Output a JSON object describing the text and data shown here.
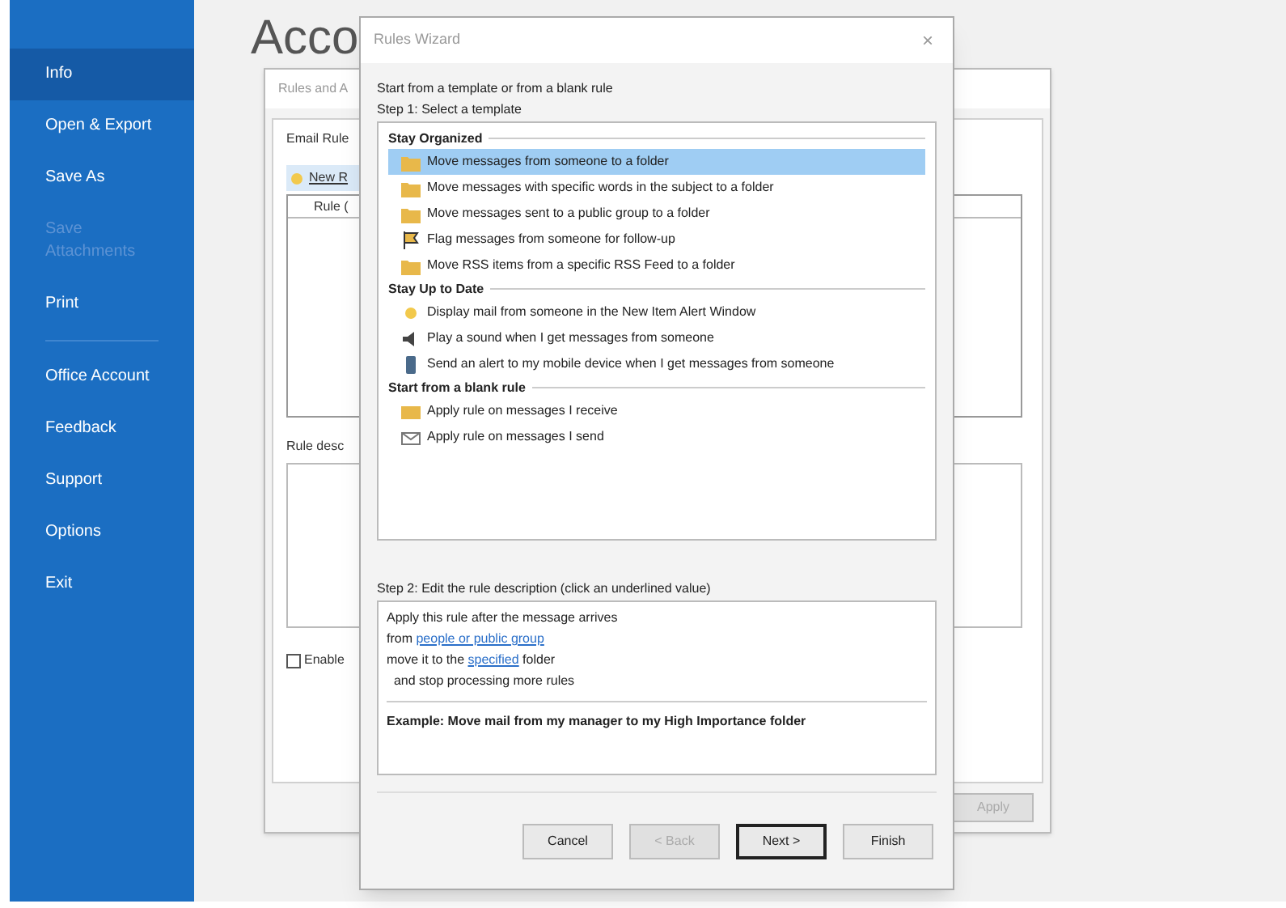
{
  "sidebar": {
    "items": [
      {
        "label": "Info",
        "selected": true,
        "disabled": false,
        "divider_after": false
      },
      {
        "label": "Open & Export",
        "selected": false,
        "disabled": false,
        "divider_after": false
      },
      {
        "label": "Save As",
        "selected": false,
        "disabled": false,
        "divider_after": false
      },
      {
        "label": "Save Attachments",
        "selected": false,
        "disabled": true,
        "divider_after": false
      },
      {
        "label": "Print",
        "selected": false,
        "disabled": false,
        "divider_after": true
      },
      {
        "label": "Office Account",
        "selected": false,
        "disabled": false,
        "divider_after": false
      },
      {
        "label": "Feedback",
        "selected": false,
        "disabled": false,
        "divider_after": false
      },
      {
        "label": "Support",
        "selected": false,
        "disabled": false,
        "divider_after": false
      },
      {
        "label": "Options",
        "selected": false,
        "disabled": false,
        "divider_after": false
      },
      {
        "label": "Exit",
        "selected": false,
        "disabled": false,
        "divider_after": false
      }
    ]
  },
  "page": {
    "heading": "Acco"
  },
  "rules_dialog": {
    "title": "Rules and A",
    "tab": "Email Rule",
    "new_button": "New R",
    "column": "Rule (",
    "description_label": "Rule desc",
    "enable": {
      "label": "Enable",
      "checked": false
    },
    "apply": {
      "label": "Apply",
      "disabled": true
    }
  },
  "wizard": {
    "title": "Rules Wizard",
    "close": "×",
    "intro": "Start from a template or from a blank rule",
    "step1": "Step 1: Select a template",
    "groups": [
      {
        "title": "Stay Organized",
        "items": [
          {
            "label": "Move messages from someone to a folder",
            "kind": "folder",
            "selected": true
          },
          {
            "label": "Move messages with specific words in the subject to a folder",
            "kind": "folder",
            "selected": false
          },
          {
            "label": "Move messages sent to a public group to a folder",
            "kind": "folder",
            "selected": false
          },
          {
            "label": "Flag messages from someone for follow-up",
            "kind": "flag",
            "selected": false
          },
          {
            "label": "Move RSS items from a specific RSS Feed to a folder",
            "kind": "folder",
            "selected": false
          }
        ]
      },
      {
        "title": "Stay Up to Date",
        "items": [
          {
            "label": "Display mail from someone in the New Item Alert Window",
            "kind": "alert",
            "selected": false
          },
          {
            "label": "Play a sound when I get messages from someone",
            "kind": "sound",
            "selected": false
          },
          {
            "label": "Send an alert to my mobile device when I get messages from someone",
            "kind": "phone",
            "selected": false
          }
        ]
      },
      {
        "title": "Start from a blank rule",
        "items": [
          {
            "label": "Apply rule on messages I receive",
            "kind": "receive",
            "selected": false
          },
          {
            "label": "Apply rule on messages I send",
            "kind": "send",
            "selected": false
          }
        ]
      }
    ],
    "step2": "Step 2: Edit the rule description (click an underlined value)",
    "description": [
      [
        {
          "text": "Apply this rule after the message arrives",
          "link": false
        }
      ],
      [
        {
          "text": "from ",
          "link": false
        },
        {
          "text": "people or public group",
          "link": true
        }
      ],
      [
        {
          "text": "move it to the ",
          "link": false
        },
        {
          "text": "specified",
          "link": true
        },
        {
          "text": " folder",
          "link": false
        }
      ],
      [
        {
          "text": "  and stop processing more rules",
          "link": false
        }
      ]
    ],
    "example": "Example: Move mail from my manager to my High Importance folder",
    "buttons": [
      {
        "label": "Cancel",
        "disabled": false,
        "default": false
      },
      {
        "label": "< Back",
        "disabled": true,
        "default": false
      },
      {
        "label": "Next >",
        "disabled": false,
        "default": true
      },
      {
        "label": "Finish",
        "disabled": false,
        "default": false
      }
    ]
  }
}
